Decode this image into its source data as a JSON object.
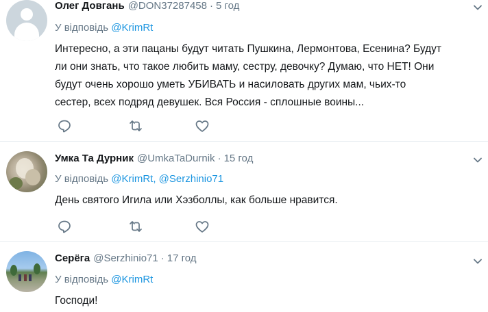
{
  "tweets": [
    {
      "name": "Олег Довгань",
      "handle": "@DON37287458",
      "separator": "·",
      "time": "5 год",
      "reply_prefix": "У відповідь",
      "mentions": [
        "@KrimRt"
      ],
      "text": "Интересно, а эти пацаны будут читать Пушкина, Лермонтова, Есенина? Будут ли они знать, что такое любить маму, сестру, девочку? Думаю, что НЕТ! Они будут очень хорошо уметь УБИВАТЬ и насиловать других мам, чьих-то сестер, всех подряд девушек. Вся Россия - сплошные воины...",
      "avatar": "default-avatar",
      "text_lines": [
        "Интересно, а эти пацаны будут читать Пушкина, Лермонтова, Есенина? Будут",
        "ли они знать, что такое любить маму, сестру, девочку? Думаю, что НЕТ! Они",
        "будут очень хорошо уметь УБИВАТЬ и насиловать других мам, чьих-то",
        "сестер, всех подряд девушек. Вся Россия - сплошные воины..."
      ]
    },
    {
      "name": "Умка Та Дурник",
      "handle": "@UmkaTaDurnik",
      "separator": "·",
      "time": "15 год",
      "reply_prefix": "У відповідь",
      "mentions": [
        "@KrimRt,",
        "@Serzhinio71"
      ],
      "text": "День святого Игила или Хэзболлы, как больше нравится.",
      "avatar": "animal-photo-avatar"
    },
    {
      "name": "Серёга",
      "handle": "@Serzhinio71",
      "separator": "·",
      "time": "17 год",
      "reply_prefix": "У відповідь",
      "mentions": [
        "@KrimRt"
      ],
      "text": "Господи!",
      "avatar": "outdoor-photo-avatar"
    }
  ],
  "icons": {
    "reply": "reply-icon",
    "retweet": "retweet-icon",
    "like": "heart-icon",
    "menu": "chevron-down-icon"
  },
  "colors": {
    "link": "#1b95e0",
    "muted": "#657786",
    "text": "#14171a",
    "divider": "#e6ecf0"
  }
}
